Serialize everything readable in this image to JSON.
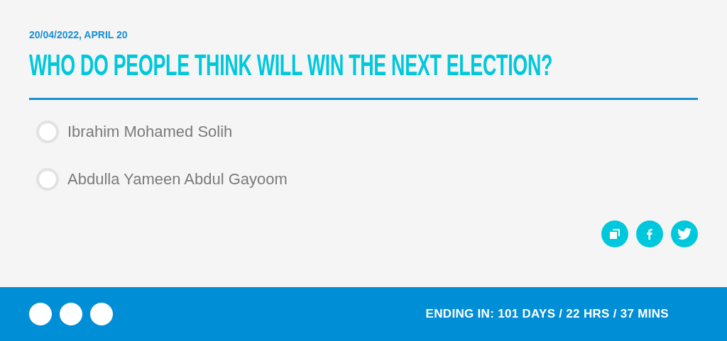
{
  "poll": {
    "date": "20/04/2022, APRIL 20",
    "question": "WHO DO PEOPLE THINK WILL WIN THE NEXT ELECTION?",
    "options": [
      {
        "label": "Ibrahim Mohamed Solih",
        "selected": false
      },
      {
        "label": "Abdulla Yameen Abdul Gayoom",
        "selected": false
      }
    ],
    "share": [
      {
        "kind": "copy"
      },
      {
        "kind": "facebook"
      },
      {
        "kind": "twitter"
      }
    ]
  },
  "footer": {
    "countdown": "ENDING IN: 101 DAYS / 22 HRS / 37 MINS"
  }
}
